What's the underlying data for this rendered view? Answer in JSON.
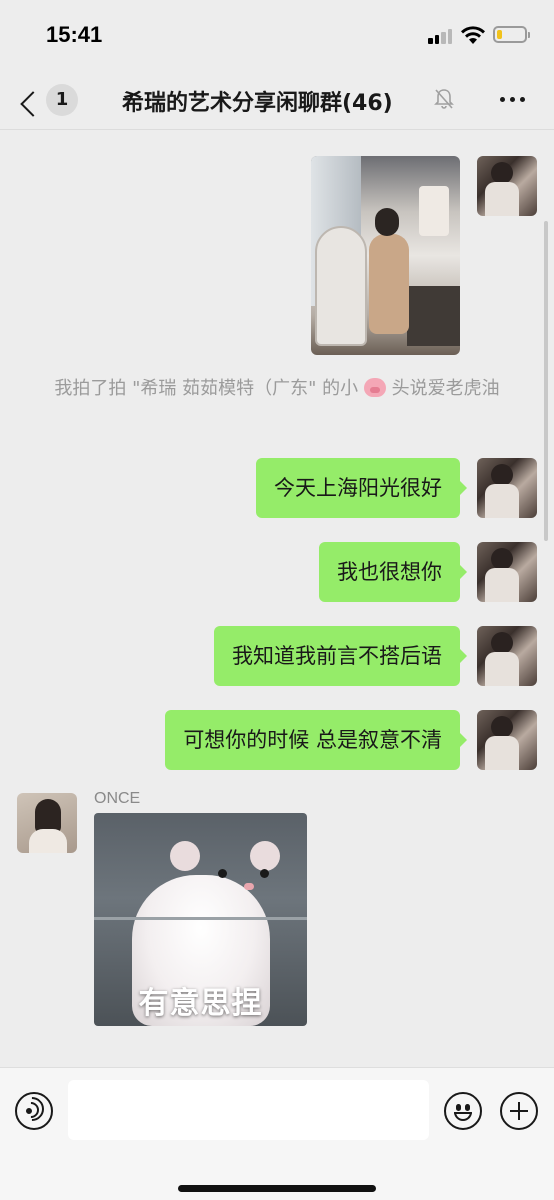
{
  "status_bar": {
    "time": "15:41",
    "battery_level": 0.18,
    "battery_color": "#f1c21b"
  },
  "nav": {
    "back_icon": "chevron-left-icon",
    "unread_count": "1",
    "title": "希瑞的艺术分享闲聊群(46)",
    "mute_icon": "bell-slash-icon",
    "more_icon": "ellipsis-icon"
  },
  "messages": {
    "photo_alt": "photo",
    "system_text": "我拍了拍 \"希瑞 茹茹模特（广东\" 的小",
    "system_emoji": "pig-icon",
    "system_text_after": " 头说爱老虎油",
    "outgoing": [
      "今天上海阳光很好",
      "我也很想你",
      "我知道我前言不搭后语",
      "可想你的时候 总是叙意不清"
    ],
    "incoming_sender": "ONCE",
    "sticker_caption": "有意思捏"
  },
  "colors": {
    "bubble_out": "#95ec69",
    "background": "#ededed",
    "system_text": "#9b9b9b"
  },
  "input": {
    "value": "",
    "placeholder": "",
    "voice_icon": "voice-icon",
    "emoji_icon": "smile-icon",
    "plus_icon": "plus-icon"
  }
}
